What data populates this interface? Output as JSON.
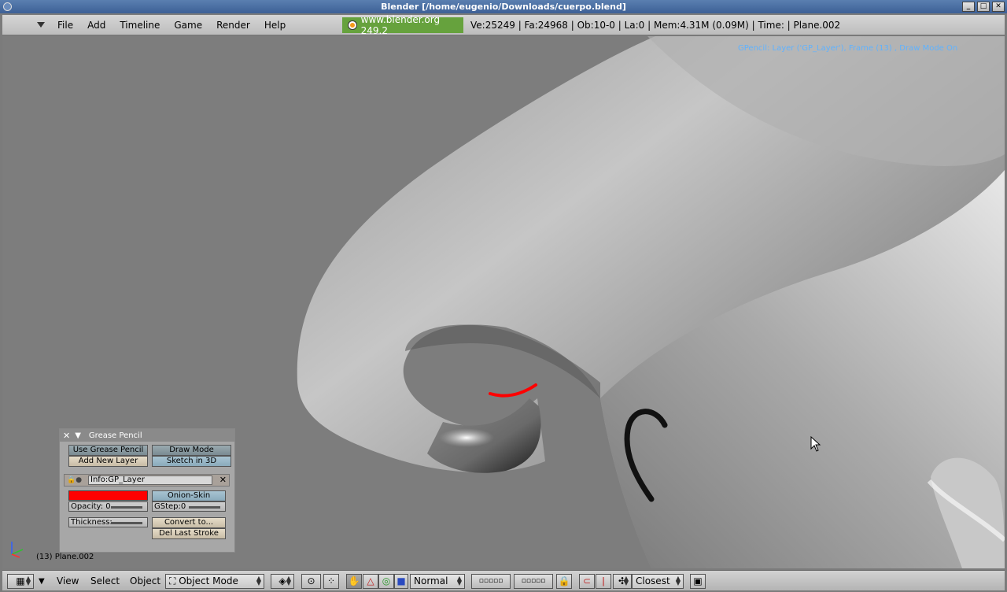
{
  "window": {
    "title": "Blender [/home/eugenio/Downloads/cuerpo.blend]",
    "buttons": [
      "_",
      "□",
      "✕"
    ]
  },
  "menubar": {
    "items": [
      "File",
      "Add",
      "Timeline",
      "Game",
      "Render",
      "Help"
    ],
    "badge": "www.blender.org 249.2",
    "stats": "Ve:25249 | Fa:24968 | Ob:10-0 | La:0  | Mem:4.31M (0.09M)  | Time: | Plane.002"
  },
  "viewport": {
    "gp_status": "GPencil: Layer ('GP_Layer'), Frame (13) , Draw Mode On",
    "object_name": "(13) Plane.002"
  },
  "grease_pencil": {
    "title": "Grease Pencil",
    "use_grease_pencil": "Use Grease Pencil",
    "draw_mode": "Draw Mode",
    "add_new_layer": "Add New Layer",
    "sketch_in_3d": "Sketch in 3D",
    "layer_info": "Info:GP_Layer",
    "layer_color": "#ff0000",
    "onion_skin": "Onion-Skin",
    "opacity_label": "Opacity: 0",
    "gstep_label": "GStep:0",
    "thickness_label": "Thickness:",
    "convert_to": "Convert to...",
    "del_last_stroke": "Del Last Stroke"
  },
  "bottombar": {
    "view": "View",
    "select": "Select",
    "object": "Object",
    "mode": "Object Mode",
    "pivot": "Normal",
    "snap": "Closest"
  }
}
